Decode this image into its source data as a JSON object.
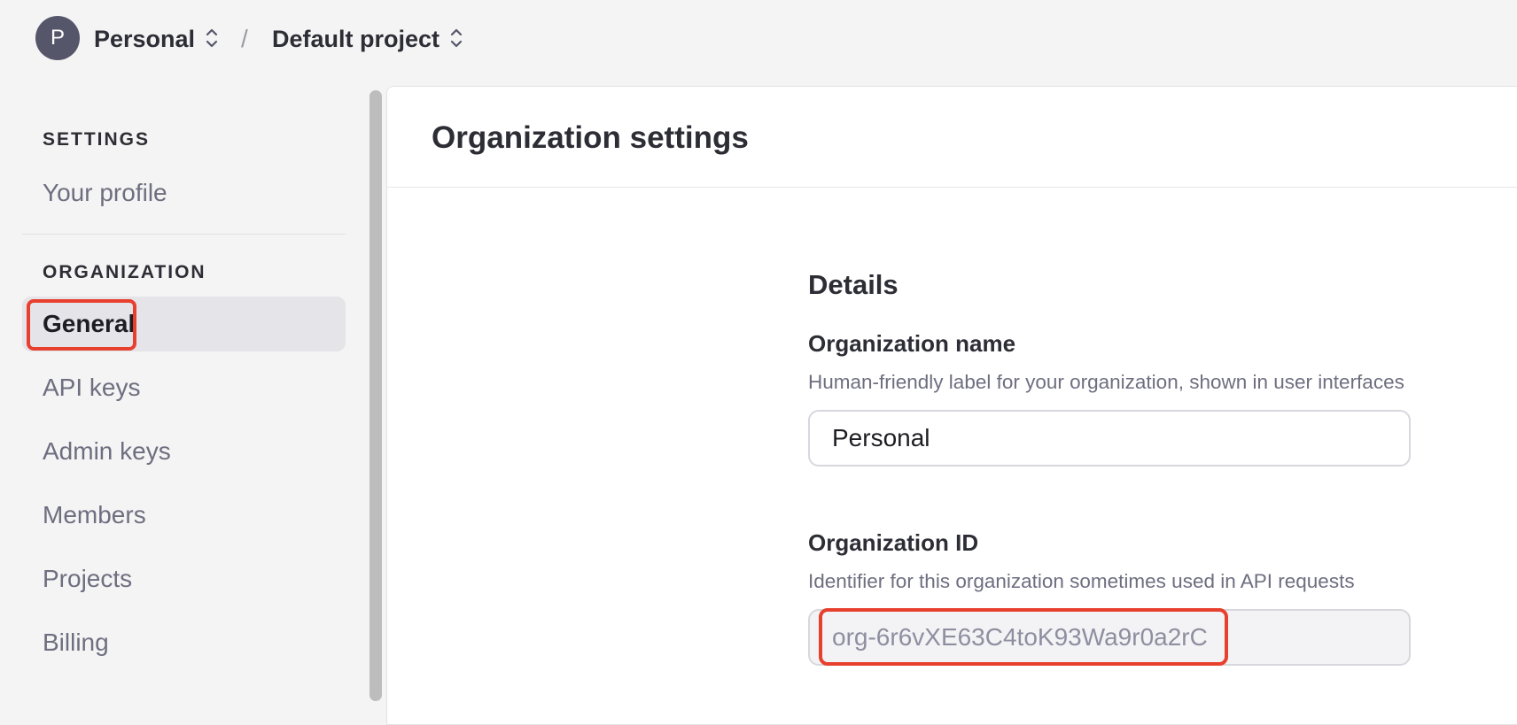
{
  "topbar": {
    "avatar_letter": "P",
    "org_name": "Personal",
    "separator": "/",
    "project_name": "Default project"
  },
  "sidebar": {
    "settings_heading": "SETTINGS",
    "settings_items": [
      {
        "label": "Your profile"
      }
    ],
    "organization_heading": "ORGANIZATION",
    "organization_items": [
      {
        "label": "General",
        "active": true
      },
      {
        "label": "API keys"
      },
      {
        "label": "Admin keys"
      },
      {
        "label": "Members"
      },
      {
        "label": "Projects"
      },
      {
        "label": "Billing"
      }
    ]
  },
  "main": {
    "title": "Organization settings",
    "details_heading": "Details",
    "org_name_field": {
      "label": "Organization name",
      "help": "Human-friendly label for your organization, shown in user interfaces",
      "value": "Personal"
    },
    "org_id_field": {
      "label": "Organization ID",
      "help": "Identifier for this organization sometimes used in API requests",
      "value": "org-6r6vXE63C4toK93Wa9r0a2rC"
    }
  },
  "colors": {
    "highlight": "#e8402e",
    "avatar_bg": "#55566a",
    "active_nav_bg": "#e4e4e9"
  },
  "icons": {
    "org_switcher": "chevron-up-down-icon",
    "project_switcher": "chevron-up-down-icon"
  }
}
